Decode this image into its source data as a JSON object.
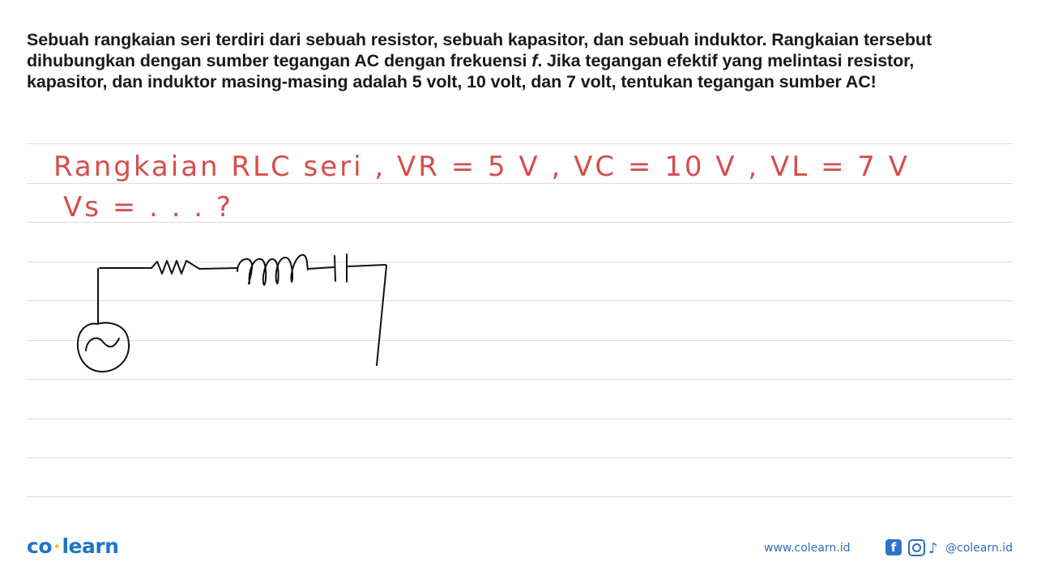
{
  "question": {
    "text_before_f": "Sebuah rangkaian seri terdiri dari sebuah resistor, sebuah kapasitor, dan sebuah induktor. Rangkaian tersebut dihubungkan dengan sumber tegangan AC dengan frekuensi ",
    "variable_f": "f",
    "text_after_f": ". Jika tegangan efektif yang melintasi resistor, kapasitor, dan induktor masing-masing adalah 5 volt, 10 volt, dan 7 volt, tentukan tegangan sumber AC!"
  },
  "handwritten": {
    "line1": "Rangkaian RLC seri ,  VR = 5 V ,  VC = 10 V  ,  VL = 7 V",
    "line2": "Vs = . . . ?"
  },
  "circuit": {
    "components": [
      "ac-source",
      "resistor",
      "inductor",
      "capacitor"
    ],
    "colors": {
      "wire": "#111111"
    }
  },
  "footer": {
    "logo_left": "co",
    "logo_right": "learn",
    "website": "www.colearn.id",
    "facebook_glyph": "f",
    "tiktok_glyph": "♪",
    "social_handle": "@colearn.id"
  },
  "colors": {
    "handwriting": "#d64d4d",
    "brand_blue": "#1f74c9",
    "brand_dot": "#f4c430",
    "rule_line": "#dddddd"
  }
}
